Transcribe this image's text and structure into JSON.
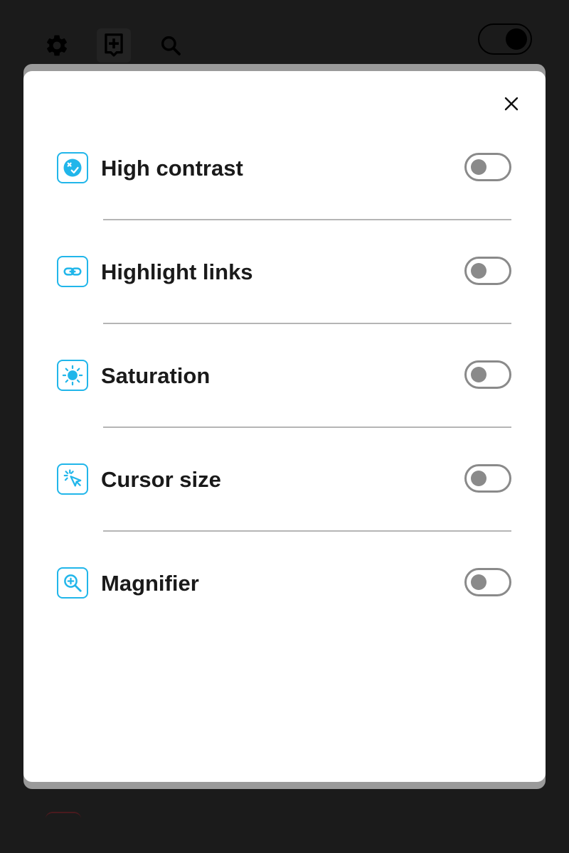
{
  "toolbar": {
    "icons": [
      "gear-icon",
      "add-bookmark-icon",
      "search-icon"
    ],
    "theme_toggle_state": "dark"
  },
  "modal": {
    "close_icon": "close-icon",
    "options": [
      {
        "label": "High contrast",
        "icon": "contrast-icon",
        "enabled": false
      },
      {
        "label": "Highlight links",
        "icon": "link-icon",
        "enabled": false
      },
      {
        "label": "Saturation",
        "icon": "sun-icon",
        "enabled": false
      },
      {
        "label": "Cursor size",
        "icon": "cursor-icon",
        "enabled": false
      },
      {
        "label": "Magnifier",
        "icon": "magnifier-icon",
        "enabled": false
      }
    ]
  },
  "colors": {
    "accent": "#21b6ea",
    "switch_off": "#8a8a8a",
    "backdrop": "#1b1b1b"
  }
}
